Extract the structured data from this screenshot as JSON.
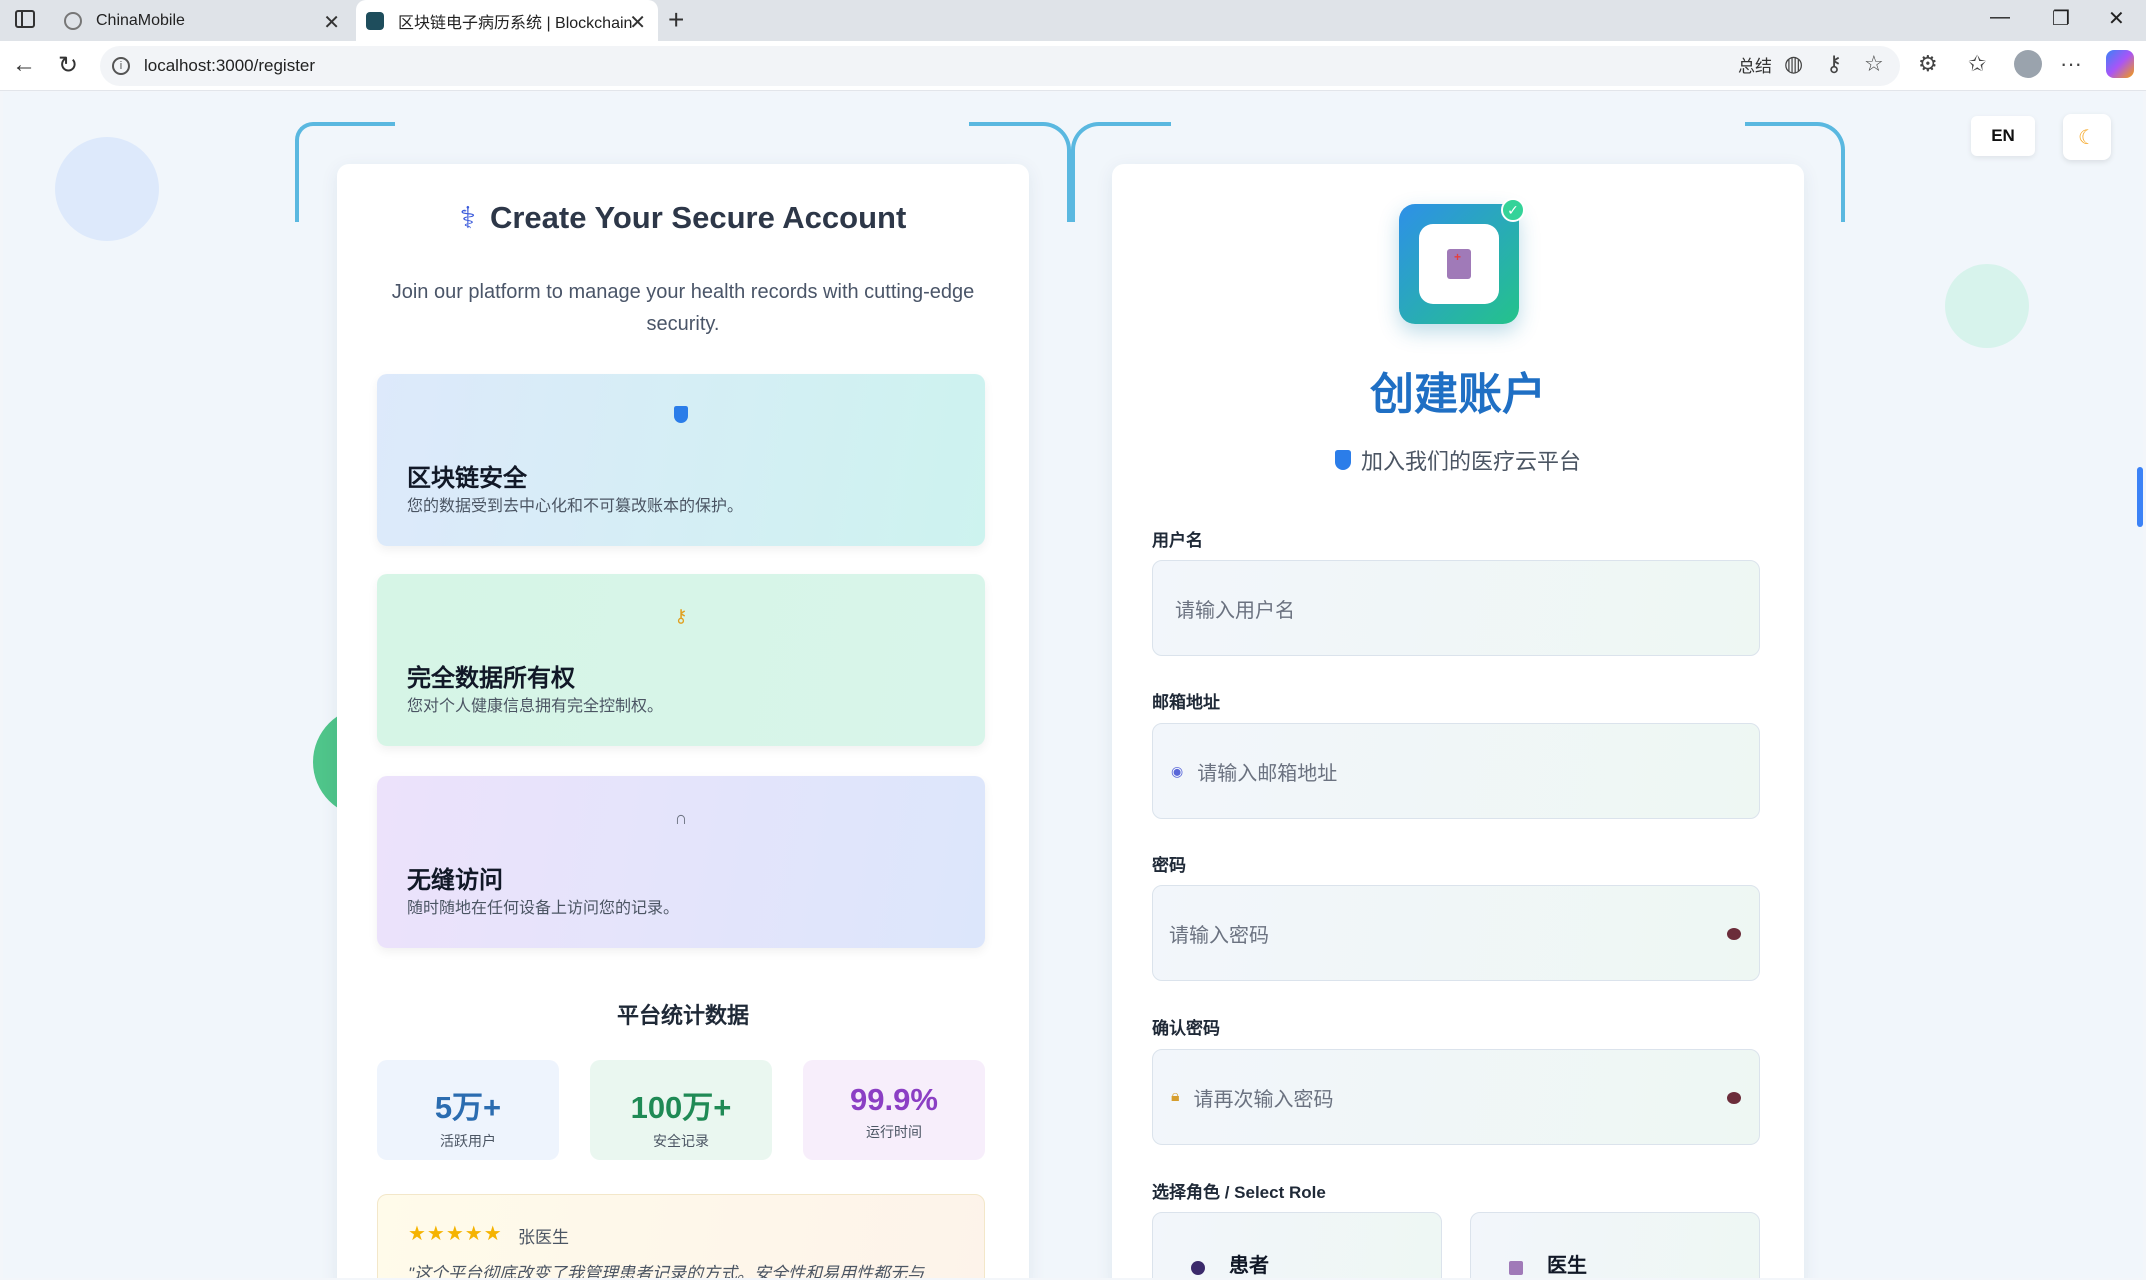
{
  "browser": {
    "tabs": [
      {
        "title": "ChinaMobile"
      },
      {
        "title": "区块链电子病历系统 | Blockchain"
      }
    ],
    "url": "localhost:3000/register",
    "summary_label": "总结"
  },
  "page": {
    "lang_toggle": "EN",
    "left": {
      "title": "Create Your Secure Account",
      "subtitle": "Join our platform to manage your health records with cutting-edge security.",
      "features": [
        {
          "icon": "shield-icon",
          "title": "区块链安全",
          "desc": "您的数据受到去中心化和不可篡改账本的保护。"
        },
        {
          "icon": "key-icon",
          "title": "完全数据所有权",
          "desc": "您对个人健康信息拥有完全控制权。"
        },
        {
          "icon": "headphones-icon",
          "title": "无缝访问",
          "desc": "随时随地在任何设备上访问您的记录。"
        }
      ],
      "stats_title": "平台统计数据",
      "stats": [
        {
          "value": "5万+",
          "label": "活跃用户"
        },
        {
          "value": "100万+",
          "label": "安全记录"
        },
        {
          "value": "99.9%",
          "label": "运行时间"
        }
      ],
      "testimonial": {
        "stars": "★★★★★",
        "author": "张医生",
        "quote": "\"这个平台彻底改变了我管理患者记录的方式。安全性和易用性都无与"
      }
    },
    "right": {
      "title": "创建账户",
      "subtitle": "加入我们的医疗云平台",
      "fields": {
        "username": {
          "label": "用户名",
          "placeholder": "请输入用户名"
        },
        "email": {
          "label": "邮箱地址",
          "placeholder": "请输入邮箱地址"
        },
        "password": {
          "label": "密码",
          "placeholder": "请输入密码"
        },
        "confirm": {
          "label": "确认密码",
          "placeholder": "请再次输入密码"
        }
      },
      "role_label": "选择角色 / Select Role",
      "roles": [
        {
          "name": "患者"
        },
        {
          "name": "医生"
        }
      ]
    }
  }
}
